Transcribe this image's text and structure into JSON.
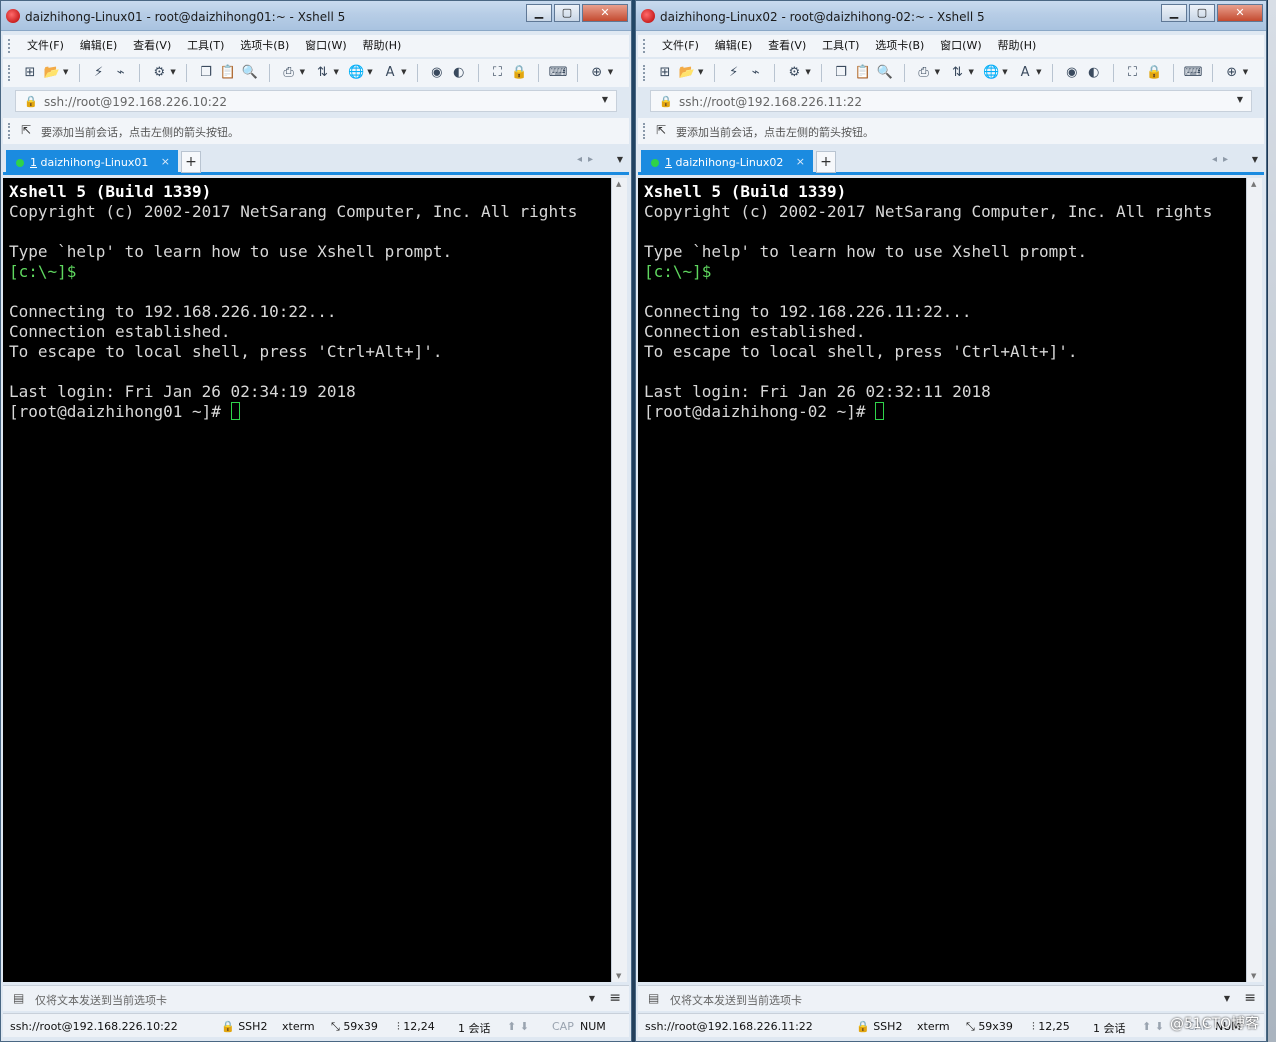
{
  "windows": [
    {
      "title": "daizhihong-Linux01 - root@daizhihong01:~ - Xshell 5",
      "menu": [
        "文件(F)",
        "编辑(E)",
        "查看(V)",
        "工具(T)",
        "选项卡(B)",
        "窗口(W)",
        "帮助(H)"
      ],
      "address": "ssh://root@192.168.226.10:22",
      "hint": "要添加当前会话，点击左侧的箭头按钮。",
      "tab": {
        "number": "1",
        "label": "daizhihong-Linux01"
      },
      "terminal": {
        "banner_title": "Xshell 5 (Build 1339)",
        "banner_copyright": "Copyright (c) 2002-2017 NetSarang Computer, Inc. All rights",
        "help_line": "Type `help' to learn how to use Xshell prompt.",
        "local_prompt": "[c:\\~]$",
        "connecting": "Connecting to 192.168.226.10:22...",
        "established": "Connection established.",
        "escape": "To escape to local shell, press 'Ctrl+Alt+]'.",
        "last_login": "Last login: Fri Jan 26 02:34:19 2018",
        "remote_prompt": "[root@daizhihong01 ~]# "
      },
      "compose_placeholder": "仅将文本发送到当前选项卡",
      "status": {
        "address": "ssh://root@192.168.226.10:22",
        "protocol": "SSH2",
        "terminal_type": "xterm",
        "size": "59x39",
        "cursor_pos": "12,24",
        "sessions": "1 会话",
        "cap": "CAP",
        "num": "NUM"
      }
    },
    {
      "title": "daizhihong-Linux02 - root@daizhihong-02:~ - Xshell 5",
      "menu": [
        "文件(F)",
        "编辑(E)",
        "查看(V)",
        "工具(T)",
        "选项卡(B)",
        "窗口(W)",
        "帮助(H)"
      ],
      "address": "ssh://root@192.168.226.11:22",
      "hint": "要添加当前会话，点击左侧的箭头按钮。",
      "tab": {
        "number": "1",
        "label": "daizhihong-Linux02"
      },
      "terminal": {
        "banner_title": "Xshell 5 (Build 1339)",
        "banner_copyright": "Copyright (c) 2002-2017 NetSarang Computer, Inc. All rights",
        "help_line": "Type `help' to learn how to use Xshell prompt.",
        "local_prompt": "[c:\\~]$",
        "connecting": "Connecting to 192.168.226.11:22...",
        "established": "Connection established.",
        "escape": "To escape to local shell, press 'Ctrl+Alt+]'.",
        "last_login": "Last login: Fri Jan 26 02:32:11 2018",
        "remote_prompt": "[root@daizhihong-02 ~]# "
      },
      "compose_placeholder": "仅将文本发送到当前选项卡",
      "status": {
        "address": "ssh://root@192.168.226.11:22",
        "protocol": "SSH2",
        "terminal_type": "xterm",
        "size": "59x39",
        "cursor_pos": "12,25",
        "sessions": "1 会话",
        "cap": "CAP",
        "num": "NUM"
      }
    }
  ],
  "watermark": "@51CTO博客",
  "colors": {
    "tab_accent": "#1b8be0",
    "terminal_bg": "#000000",
    "prompt_green": "#5fd75f",
    "cursor_green": "#2fd34a"
  }
}
